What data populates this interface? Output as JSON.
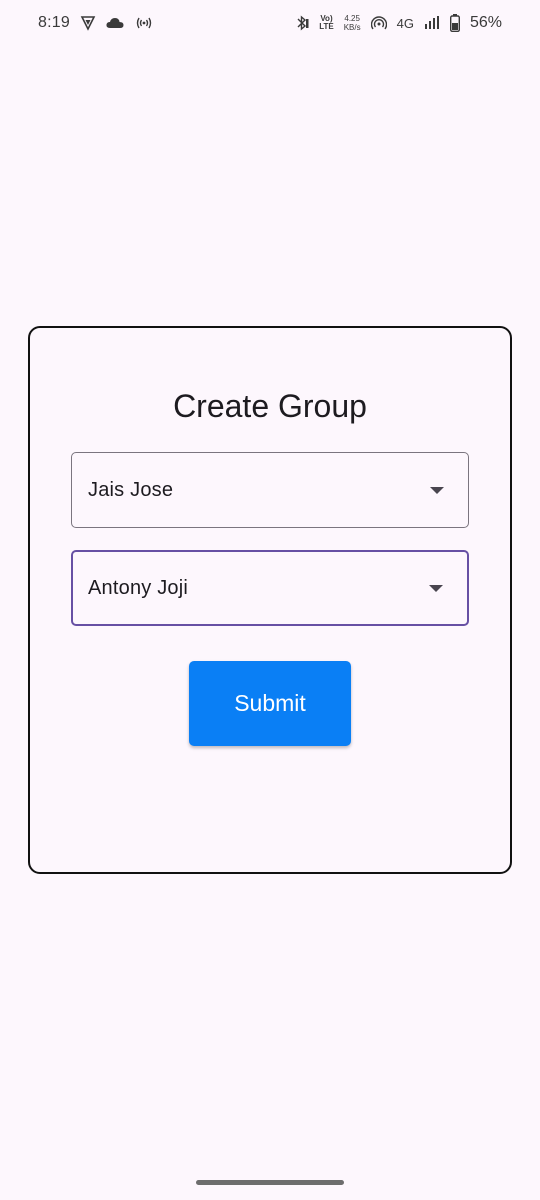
{
  "status_bar": {
    "time": "8:19",
    "volte_top": "Vo)",
    "volte_bottom": "LTE",
    "speed_value": "4.25",
    "speed_unit": "KB/s",
    "network": "4G",
    "battery_percent": "56%"
  },
  "form": {
    "title": "Create Group",
    "member_one": "Jais Jose",
    "member_two": "Antony Joji",
    "submit_label": "Submit"
  },
  "colors": {
    "background": "#fdf7fd",
    "submit_button": "#0a7ff5",
    "focused_outline": "#6750a4",
    "card_border": "#111111"
  }
}
